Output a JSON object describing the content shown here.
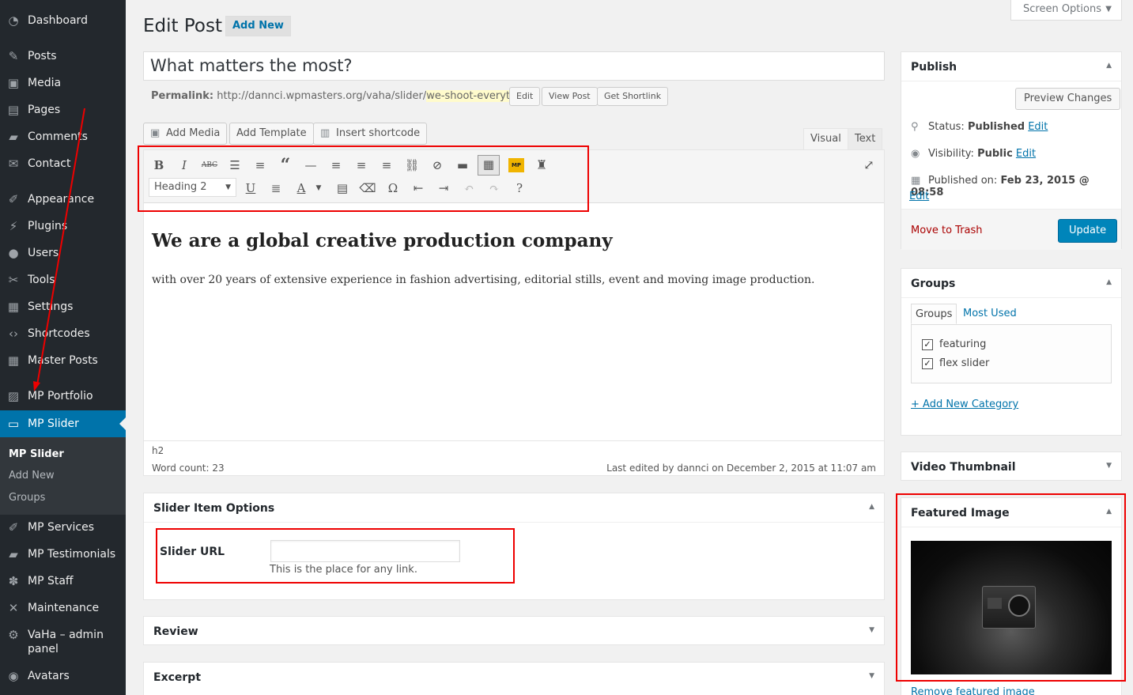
{
  "sidebar": {
    "items": [
      {
        "label": "Dashboard",
        "icon": "dashboard-icon",
        "glyph": "◔"
      },
      {
        "label": "Posts",
        "icon": "pin-icon",
        "glyph": "✎"
      },
      {
        "label": "Media",
        "icon": "media-icon",
        "glyph": "▣"
      },
      {
        "label": "Pages",
        "icon": "pages-icon",
        "glyph": "▤"
      },
      {
        "label": "Comments",
        "icon": "comments-icon",
        "glyph": "▰"
      },
      {
        "label": "Contact",
        "icon": "mail-icon",
        "glyph": "✉"
      },
      {
        "label": "Appearance",
        "icon": "brush-icon",
        "glyph": "✐"
      },
      {
        "label": "Plugins",
        "icon": "plug-icon",
        "glyph": "⚡"
      },
      {
        "label": "Users",
        "icon": "user-icon",
        "glyph": "●"
      },
      {
        "label": "Tools",
        "icon": "wrench-icon",
        "glyph": "✂"
      },
      {
        "label": "Settings",
        "icon": "settings-icon",
        "glyph": "▦"
      },
      {
        "label": "Shortcodes",
        "icon": "code-icon",
        "glyph": "‹›"
      },
      {
        "label": "Master Posts",
        "icon": "grid-icon",
        "glyph": "▦"
      },
      {
        "label": "MP Portfolio",
        "icon": "portfolio-icon",
        "glyph": "▨"
      },
      {
        "label": "MP Slider",
        "icon": "monitor-icon",
        "glyph": "▭"
      },
      {
        "label": "MP Services",
        "icon": "hammer-icon",
        "glyph": "✐"
      },
      {
        "label": "MP Testimonials",
        "icon": "quote-icon",
        "glyph": "▰"
      },
      {
        "label": "MP Staff",
        "icon": "staff-icon",
        "glyph": "✽"
      },
      {
        "label": "Maintenance",
        "icon": "tools-icon",
        "glyph": "✕"
      },
      {
        "label": "VaHa – admin panel",
        "icon": "gear-icon",
        "glyph": "⚙"
      },
      {
        "label": "Avatars",
        "icon": "avatar-icon",
        "glyph": "◉"
      }
    ],
    "submenu": [
      "MP Slider",
      "Add New",
      "Groups"
    ]
  },
  "header": {
    "title": "Edit Post",
    "add_new": "Add New",
    "screen_options": "Screen Options"
  },
  "post": {
    "title": "What matters the most?",
    "permalink_label": "Permalink:",
    "permalink_base": "http://dannci.wpmasters.org/vaha/slider/",
    "permalink_slug": "we-shoot-everything",
    "permalink_end": "/",
    "edit_btn": "Edit",
    "view_btn": "View Post",
    "shortlink_btn": "Get Shortlink"
  },
  "editor": {
    "add_media": "Add Media",
    "add_template": "Add Template",
    "insert_shortcode": "Insert shortcode",
    "tab_visual": "Visual",
    "tab_text": "Text",
    "format_select": "Heading 2",
    "heading": "We are a global creative production company",
    "paragraph": "with over 20 years of extensive experience in fashion advertising, editorial stills, event and moving image production.",
    "path": "h2",
    "word_count": "Word count: 23",
    "last_edited": "Last edited by dannci on December 2, 2015 at 11:07 am",
    "mp_badge": "MP"
  },
  "slider_options": {
    "title": "Slider Item Options",
    "url_label": "Slider URL",
    "url_value": "",
    "url_desc": "This is the place for any link."
  },
  "review": {
    "title": "Review"
  },
  "excerpt": {
    "title": "Excerpt"
  },
  "publish": {
    "title": "Publish",
    "preview": "Preview Changes",
    "status_label": "Status:",
    "status_value": "Published",
    "visibility_label": "Visibility:",
    "visibility_value": "Public",
    "published_label": "Published on:",
    "published_value": "Feb 23, 2015 @ 08:58",
    "edit": "Edit",
    "trash": "Move to Trash",
    "update": "Update"
  },
  "groups": {
    "title": "Groups",
    "tab_all": "Groups",
    "tab_used": "Most Used",
    "items": [
      "featuring",
      "flex slider"
    ],
    "check": "✓",
    "add_new": "+ Add New Category"
  },
  "video_thumbnail": {
    "title": "Video Thumbnail"
  },
  "featured_image": {
    "title": "Featured Image",
    "remove": "Remove featured image"
  },
  "colors": {
    "accent": "#0073aa",
    "sidebar_bg": "#23282d",
    "annotation_red": "#e00000",
    "update_btn": "#0085ba"
  }
}
